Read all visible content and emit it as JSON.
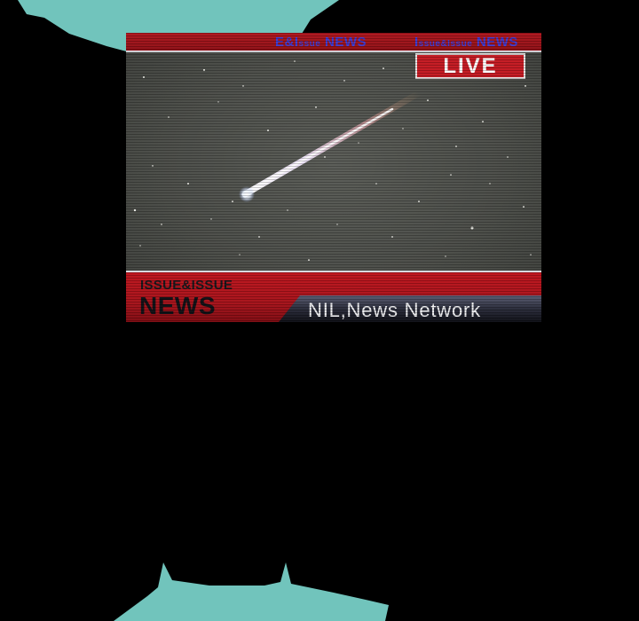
{
  "broadcast": {
    "live_label": "LIVE",
    "ticker_items": [
      {
        "prefix": "E&I",
        "small": "ssue",
        "suffix": " NEWS"
      },
      {
        "prefix": "I",
        "small": "ssue&Issue",
        "suffix": " NEWS"
      }
    ],
    "brand_top": "ISSUE&ISSUE",
    "brand_main": "NEWS",
    "network_name": "NIL,News Network"
  },
  "colors": {
    "speech_bubble": "#71c4bc",
    "broadcast_red": "#b8151d",
    "ticker_text": "#3a3bd6",
    "background": "#000000"
  }
}
